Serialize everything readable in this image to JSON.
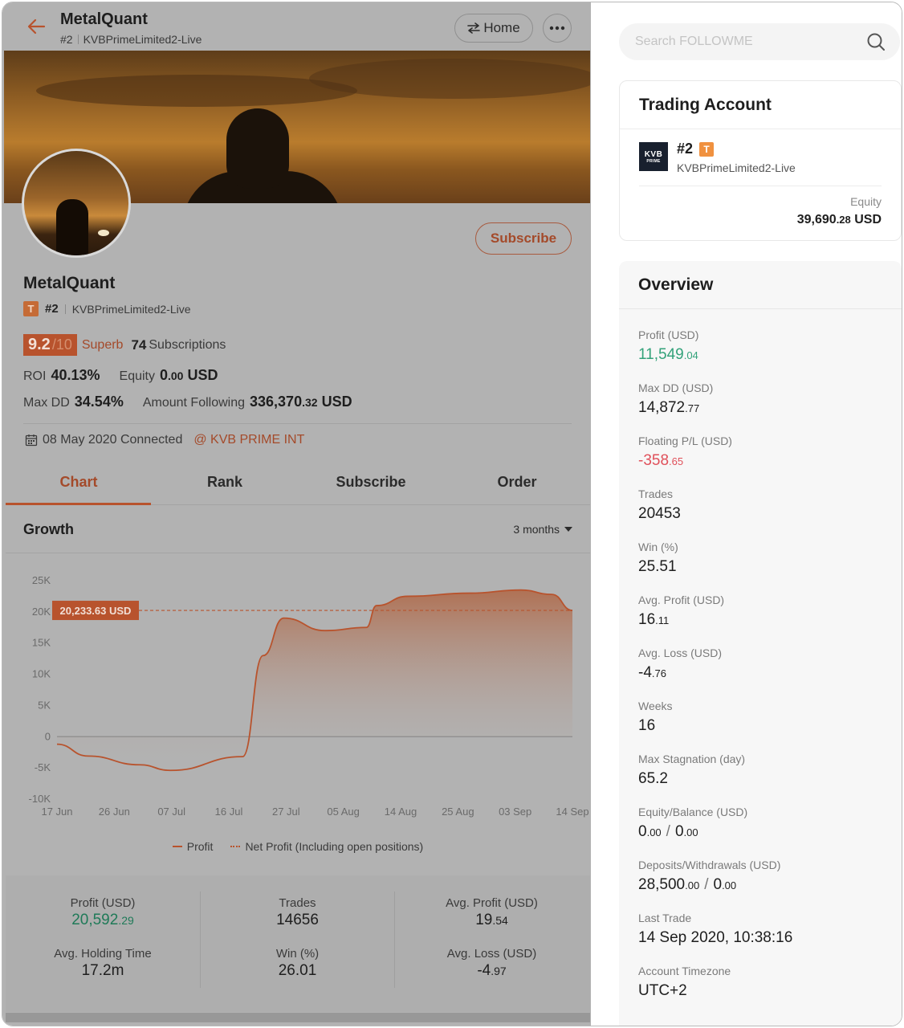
{
  "header": {
    "title": "MetalQuant",
    "account_num": "#2",
    "account_name": "KVBPrimeLimited2-Live",
    "home_label": "Home"
  },
  "profile": {
    "name": "MetalQuant",
    "badge": "T",
    "account_num": "#2",
    "account_name": "KVBPrimeLimited2-Live",
    "subscribe_label": "Subscribe",
    "score": "9.2",
    "score_den": "/10",
    "rating": "Superb",
    "subscriptions_count": "74",
    "subscriptions_label": "Subscriptions",
    "roi_label": "ROI",
    "roi_value": "40.13%",
    "equity_label": "Equity",
    "equity_int": "0",
    "equity_dec": ".00",
    "equity_unit": "USD",
    "maxdd_label": "Max DD",
    "maxdd_value": "34.54%",
    "following_label": "Amount Following",
    "following_int": "336,370",
    "following_dec": ".32",
    "following_unit": "USD",
    "connected": "08 May 2020 Connected",
    "broker": "@ KVB PRIME INT"
  },
  "tabs": [
    "Chart",
    "Rank",
    "Subscribe",
    "Order"
  ],
  "growth": {
    "title": "Growth",
    "range": "3 months"
  },
  "chart_data": {
    "type": "area",
    "x": [
      "17 Jun",
      "26 Jun",
      "07 Jul",
      "16 Jul",
      "27 Jul",
      "05 Aug",
      "14 Aug",
      "25 Aug",
      "03 Sep",
      "14 Sep"
    ],
    "yticks": [
      "25K",
      "20K",
      "15K",
      "10K",
      "5K",
      "0",
      "-5K",
      "-10K"
    ],
    "ylim": [
      -10000,
      25000
    ],
    "series": [
      {
        "name": "Profit",
        "values": [
          -1200,
          -3100,
          -4500,
          -5400,
          -3200,
          13000,
          19000,
          17000,
          17500,
          21000,
          22500,
          23000,
          23500,
          22800,
          20233
        ]
      },
      {
        "name": "Net Profit (Including open positions)",
        "values": [
          20233
        ]
      }
    ],
    "current_label": "20,233.63 USD",
    "current_value": 20233.63
  },
  "legend": {
    "profit": "Profit",
    "net": "Net Profit (Including open positions)"
  },
  "summary": [
    {
      "label": "Profit (USD)",
      "int": "20,592",
      "dec": ".29",
      "color": "green"
    },
    {
      "label": "Trades",
      "int": "14656",
      "dec": ""
    },
    {
      "label": "Avg. Profit (USD)",
      "int": "19",
      "dec": ".54"
    },
    {
      "label": "Avg. Holding Time",
      "int": "17.2m",
      "dec": ""
    },
    {
      "label": "Win (%)",
      "int": "26.01",
      "dec": ""
    },
    {
      "label": "Avg. Loss (USD)",
      "int": "-4",
      "dec": ".97"
    }
  ],
  "search": {
    "placeholder": "Search FOLLOWME"
  },
  "trading_account": {
    "title": "Trading Account",
    "logo_text": "KVB",
    "logo_sub": "PRIME",
    "num": "#2",
    "badge": "T",
    "name": "KVBPrimeLimited2-Live",
    "equity_label": "Equity",
    "equity_int": "39,690",
    "equity_dec": ".28",
    "equity_unit": "USD"
  },
  "overview": {
    "title": "Overview",
    "items": [
      {
        "label": "Profit (USD)",
        "int": "11,549",
        "dec": ".04",
        "color": "green"
      },
      {
        "label": "Max DD (USD)",
        "int": "14,872",
        "dec": ".77"
      },
      {
        "label": "Floating P/L (USD)",
        "int": "-358",
        "dec": ".65",
        "color": "red"
      },
      {
        "label": "Trades",
        "int": "20453",
        "dec": ""
      },
      {
        "label": "Win (%)",
        "int": "25.51",
        "dec": ""
      },
      {
        "label": "Avg. Profit (USD)",
        "int": "16",
        "dec": ".11"
      },
      {
        "label": "Avg. Loss (USD)",
        "int": "-4",
        "dec": ".76"
      },
      {
        "label": "Weeks",
        "int": "16",
        "dec": ""
      },
      {
        "label": "Max Stagnation (day)",
        "int": "65.2",
        "dec": ""
      },
      {
        "label": "Equity/Balance (USD)",
        "int": "0",
        "dec": ".00",
        "int2": "0",
        "dec2": ".00"
      },
      {
        "label": "Deposits/Withdrawals (USD)",
        "int": "28,500",
        "dec": ".00",
        "int2": "0",
        "dec2": ".00"
      },
      {
        "label": "Last Trade",
        "int": "14 Sep 2020, 10:38:16",
        "dec": ""
      },
      {
        "label": "Account Timezone",
        "int": "UTC+2",
        "dec": ""
      }
    ]
  },
  "colors": {
    "accent": "#e8613a",
    "green": "#33a27a",
    "red": "#e0505a"
  }
}
